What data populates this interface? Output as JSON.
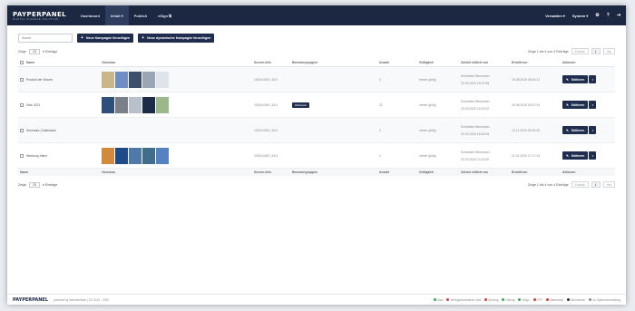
{
  "app": {
    "logo": "PAYPERPANEL",
    "tagline": "DIGITAL SIGNAGE SOLUTION"
  },
  "nav": {
    "items": [
      {
        "label": "Dashboard"
      },
      {
        "label": "Inhalt ▾"
      },
      {
        "label": "Publish"
      },
      {
        "label": "eSign ⧉"
      }
    ],
    "right": {
      "verwalten": "Verwalten ▾",
      "system": "System ▾"
    }
  },
  "toolbar": {
    "search_placeholder": "Suche",
    "btn_new_campaign": "Neue Kampagne hinzufügen",
    "btn_new_dynamic": "Neue dynamische Kampagne hinzufügen"
  },
  "pager": {
    "show_label": "Zeige",
    "page_size": "25",
    "entries_label": "▾ Einträge",
    "summary_top": "Zeige 1 bis 4 von 4 Einträge",
    "summary_bottom": "Zeige 1 bis 4 von 4 Einträge",
    "prev": "Zurück",
    "current": "1",
    "next": "Vor"
  },
  "table": {
    "headers": [
      "Name",
      "Vorschau",
      "Screen-Info",
      "Benutzergruppen",
      "Anzahl",
      "Gültigkeit",
      "Zuletzt editiert von",
      "Erstellt am",
      "Aktionen"
    ],
    "footer_headers": [
      "Name",
      "Vorschau",
      "Screen-Info",
      "Benutzergruppen",
      "Anzahl",
      "Gültigkeit",
      "Zuletzt editiert von",
      "Erstellt am",
      "Aktionen"
    ],
    "rows": [
      {
        "name": "Produkt der Woche",
        "screen": "1920x1080 | 16:9",
        "group": "",
        "count": "4",
        "validity": "immer gültig",
        "editor": "Schneider Bienmann",
        "edited": "22.03.2020 15:37:58",
        "created": "15.08.2019 08:00:12",
        "thumbs": [
          "#c9b78a",
          "#6f8fc4",
          "#3d4f6a",
          "#9aa6b4",
          "#dfe3ea"
        ]
      },
      {
        "name": "Sale 2021",
        "screen": "1920x1080 | 16:9",
        "group": "Mitarbeiter",
        "count": "21",
        "validity": "immer gültig",
        "editor": "Schneider Bienmann",
        "edited": "22.03.2020 15:23:02",
        "created": "26.08.2019 09:47:24",
        "thumbs": [
          "#2d4f7a",
          "#7a7f88",
          "#b8c0cc",
          "#1c2c48",
          "#9bb88a"
        ]
      },
      {
        "name": "Seminare_Datenbank",
        "screen": "1920x1080 | 16:9",
        "group": "",
        "count": "3",
        "validity": "immer gültig",
        "editor": "Schneider Bienmann",
        "edited": "22.03.2020 16:00:53",
        "created": "14.11.2019 16:09:43",
        "thumbs": []
      },
      {
        "name": "Werbung Intern",
        "screen": "1920x1080 | 16:9",
        "group": "",
        "count": "2",
        "validity": "immer gültig",
        "editor": "Schneider Bienmann",
        "edited": "22.03.2020 14:22:50",
        "created": "21.01.2020 17:17:24",
        "thumbs": [
          "#d08a3a",
          "#1e4a8a",
          "#4f7aa8",
          "#3f6e8c",
          "#5582c0"
        ]
      }
    ],
    "edit_label": "Editieren"
  },
  "footer": {
    "logo": "PAYPERPANEL",
    "version": "powered by Webinterface | 5.3 2019 - 2020",
    "links": [
      {
        "label": "Jobs",
        "color": "#3aa655"
      },
      {
        "label": "Verfügbarkeitsliste Jobs",
        "color": "#d23b3b"
      },
      {
        "label": "Syncing",
        "color": "#d23b3b"
      },
      {
        "label": "Pairing",
        "color": "#3aa655"
      },
      {
        "label": "eSign",
        "color": "#3aa655"
      },
      {
        "label": "FTP",
        "color": "#d23b3b"
      },
      {
        "label": "Datenbank",
        "color": "#d23b3b"
      },
      {
        "label": "Übersetzen",
        "color": "#1f2d4e"
      },
      {
        "label": "Zu Systemverwaltung",
        "color": "#888888"
      }
    ]
  }
}
